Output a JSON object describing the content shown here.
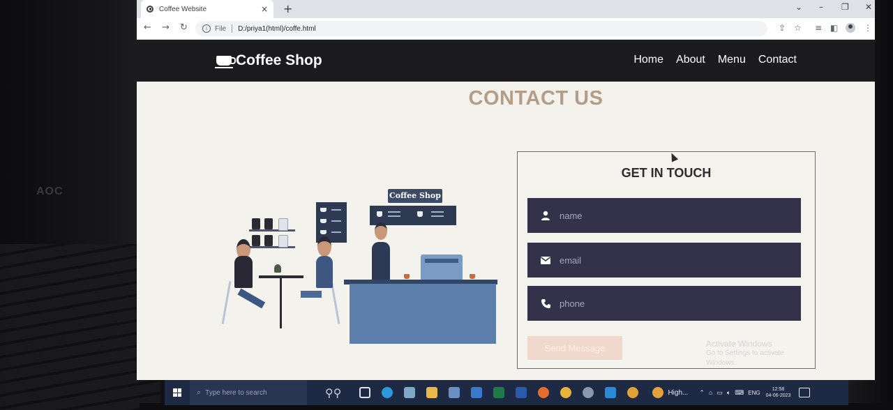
{
  "browser": {
    "tab_title": "Coffee Website",
    "tab_close": "×",
    "new_tab": "+",
    "url_scheme": "File",
    "url": "D:/priya1(html)/coffe.html",
    "icons": [
      "back-icon",
      "forward-icon",
      "reload-icon",
      "info-icon",
      "share-icon",
      "star-icon",
      "reading-list-icon",
      "sidebar-icon",
      "profile-icon",
      "menu-icon"
    ]
  },
  "site": {
    "brand": "Coffee Shop",
    "nav": [
      "Home",
      "About",
      "Menu",
      "Contact"
    ],
    "section_title": "CONTACT US",
    "illustration": {
      "sign": "Coffee Shop"
    },
    "form": {
      "heading": "GET IN TOUCH",
      "name_placeholder": "name",
      "email_placeholder": "email",
      "phone_placeholder": "phone",
      "submit_label": "Send Message"
    },
    "watermark": {
      "line1": "Activate Windows",
      "line2": "Go to Settings to activate Windows."
    }
  },
  "taskbar": {
    "search_placeholder": "Type here to search",
    "weather_text": "High...",
    "language": "ENG",
    "time": "12:58",
    "date": "04-06-2023"
  },
  "photo": {
    "monitor_brand": "AOC"
  },
  "colors": {
    "nav_bg": "#1b1b1e",
    "page_bg": "#f3f2ec",
    "title_color": "#b49d87",
    "field_bg": "#34324a",
    "button_bg": "#f0d9cc"
  }
}
